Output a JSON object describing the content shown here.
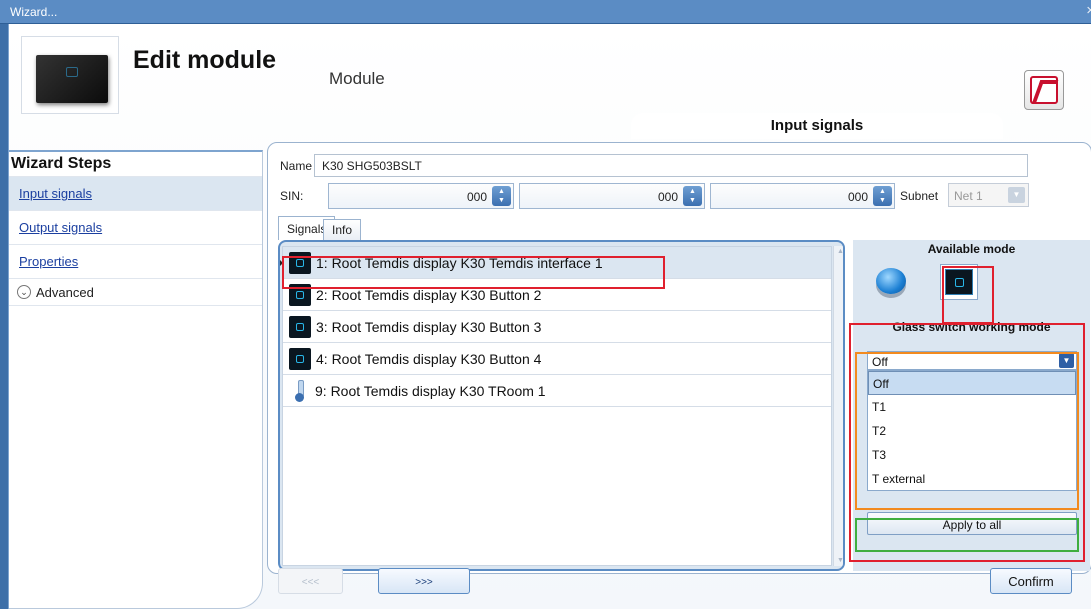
{
  "window": {
    "title": "Wizard...",
    "close": "×"
  },
  "header": {
    "title": "Edit module",
    "subtitle": "Module",
    "section_tab": "Input signals"
  },
  "sidebar": {
    "title": "Wizard Steps",
    "items": [
      {
        "label": "Input signals"
      },
      {
        "label": "Output signals"
      },
      {
        "label": "Properties"
      }
    ],
    "advanced": "Advanced"
  },
  "form": {
    "name_label": "Name",
    "name_value": "K30 SHG503BSLT",
    "sin_label": "SIN:",
    "sin_values": [
      "000",
      "000",
      "000"
    ],
    "subnet_label": "Subnet",
    "subnet_value": "Net 1"
  },
  "tabs": [
    "Signals",
    "Info"
  ],
  "signals": [
    {
      "label": "1: Root Temdis display K30 Temdis interface 1",
      "icon": "display-icon"
    },
    {
      "label": "2: Root Temdis display K30 Button 2",
      "icon": "button-icon"
    },
    {
      "label": "3: Root Temdis display K30 Button 3",
      "icon": "button-icon"
    },
    {
      "label": "4: Root Temdis display K30 Button 4",
      "icon": "button-icon"
    },
    {
      "label": "9: Root Temdis display K30 TRoom 1",
      "icon": "thermometer-icon"
    }
  ],
  "mode_panel": {
    "available_title": "Available mode",
    "glass_title": "Glass switch working mode",
    "selected": "Off",
    "options": [
      "Off",
      "T1",
      "T2",
      "T3",
      "T external"
    ],
    "apply_label": "Apply to all"
  },
  "nav": {
    "prev": "<<<",
    "next": ">>>",
    "confirm": "Confirm"
  },
  "colors": {
    "highlight_red": "#e0202e",
    "highlight_orange": "#f28a1f",
    "highlight_green": "#3fae3f",
    "accent": "#5b8cc4"
  }
}
